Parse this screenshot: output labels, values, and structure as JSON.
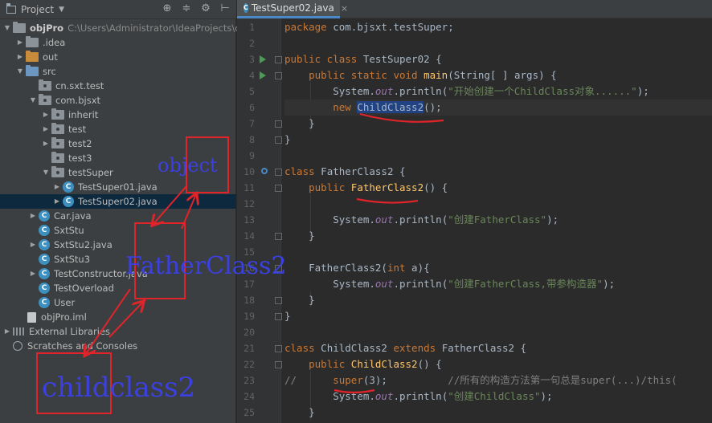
{
  "project_panel": {
    "title": "Project",
    "tools": [
      "target-icon",
      "collapse-icon",
      "gear-icon",
      "hide-icon"
    ],
    "root": {
      "name": "objPro",
      "path": "C:\\Users\\Administrator\\IdeaProjects\\objPro"
    },
    "items": [
      {
        "label": ".idea"
      },
      {
        "label": "out"
      },
      {
        "label": "src"
      },
      {
        "label": "cn.sxt.test"
      },
      {
        "label": "com.bjsxt"
      },
      {
        "label": "inherit"
      },
      {
        "label": "test"
      },
      {
        "label": "test2"
      },
      {
        "label": "test3"
      },
      {
        "label": "testSuper"
      },
      {
        "label": "TestSuper01.java"
      },
      {
        "label": "TestSuper02.java"
      },
      {
        "label": "Car.java"
      },
      {
        "label": "SxtStu"
      },
      {
        "label": "SxtStu2.java"
      },
      {
        "label": "SxtStu3"
      },
      {
        "label": "TestConstructor.java"
      },
      {
        "label": "TestOverload"
      },
      {
        "label": "User"
      },
      {
        "label": "objPro.iml"
      },
      {
        "label": "External Libraries"
      },
      {
        "label": "Scratches and Consoles"
      }
    ]
  },
  "editor": {
    "tab": {
      "label": "TestSuper02.java",
      "close": "×"
    },
    "line_numbers": [
      "1",
      "2",
      "3",
      "4",
      "5",
      "6",
      "7",
      "8",
      "9",
      "10",
      "11",
      "12",
      "13",
      "14",
      "15",
      "16",
      "17",
      "18",
      "19",
      "20",
      "21",
      "22",
      "23",
      "24",
      "25"
    ],
    "code": {
      "l1_kw": "package",
      "l1_rest": " com.bjsxt.testSuper;",
      "l3_kw": "public class",
      "l3_rest": " TestSuper02 {",
      "l4_kw": "public static void",
      "l4_fn": "main",
      "l4_rest": "(String[ ] args) {",
      "l5_a": "System.",
      "l5_out": "out",
      "l5_b": ".println(",
      "l5_str": "\"开始创建一个ChildClass对象......\"",
      "l5_c": ");",
      "l6_kw": "new",
      "l6_hl": "ChildClass2",
      "l6_rest": "();",
      "l7": "}",
      "l8": "}",
      "l10_kw": "class",
      "l10_rest": " FatherClass2 {",
      "l11_kw": "public",
      "l11_fn": "FatherClass2",
      "l11_rest": "() {",
      "l13_a": "System.",
      "l13_out": "out",
      "l13_b": ".println(",
      "l13_str": "\"创建FatherClass\"",
      "l13_c": ");",
      "l14": "}",
      "l16_a": "FatherClass2(",
      "l16_kw": "int",
      "l16_b": " a){",
      "l17_a": "System.",
      "l17_out": "out",
      "l17_b": ".println(",
      "l17_str": "\"创建FatherClass,带参构造器\"",
      "l17_c": ");",
      "l18": "}",
      "l19": "}",
      "l21_kw": "class",
      "l21_a": " ChildClass2 ",
      "l21_kw2": "extends",
      "l21_b": " FatherClass2 {",
      "l22_kw": "public",
      "l22_fn": "ChildClass2",
      "l22_rest": "() {",
      "l23_c": "//",
      "l23_a": "super",
      "l23_b": "(3);",
      "l23_cmt": "//所有的构造方法第一句总是super(...)/this(",
      "l24_a": "System.",
      "l24_out": "out",
      "l24_b": ".println(",
      "l24_str": "\"创建ChildClass\"",
      "l24_c": ");",
      "l25": "}"
    }
  },
  "annotations": {
    "object": "object",
    "father": "FatherClass2",
    "child": "childclass2",
    "color_box": "#e0242a",
    "color_text": "#3b40e0"
  }
}
